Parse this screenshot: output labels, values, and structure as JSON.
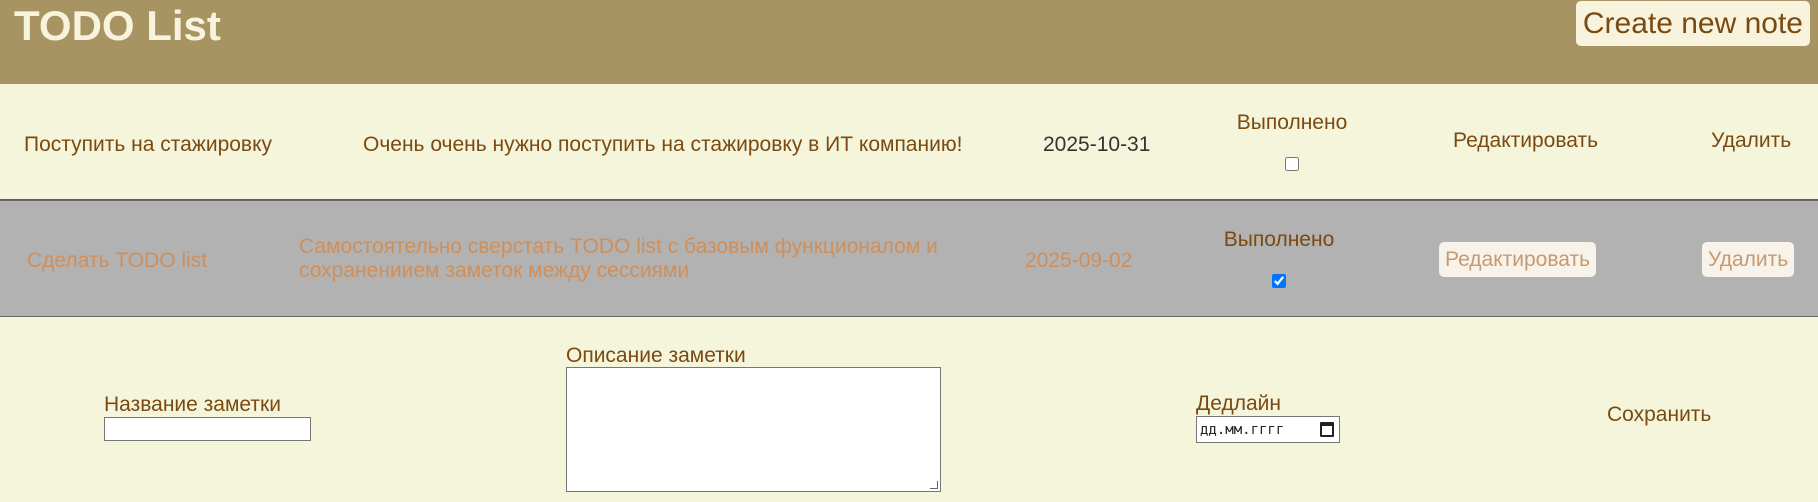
{
  "header": {
    "title": "TODO List",
    "create_label": "Create new note"
  },
  "notes": [
    {
      "title": "Поступить на стажировку",
      "description": "Очень очень нужно поступить на стажировку в ИТ компанию!",
      "deadline": "2025-10-31",
      "status_label": "Выполнено",
      "done": false,
      "edit_label": "Редактировать",
      "delete_label": "Удалить"
    },
    {
      "title": "Сделать TODO list",
      "description": "Самостоятельно сверстать TODO list с базовым функционалом и сохранениием заметок между сессиями",
      "deadline": "2025-09-02",
      "status_label": "Выполнено",
      "done": true,
      "edit_label": "Редактировать",
      "delete_label": "Удалить"
    }
  ],
  "form": {
    "title_label": "Название заметки",
    "title_value": "",
    "description_label": "Описание заметки",
    "description_value": "",
    "deadline_label": "Дедлайн",
    "deadline_placeholder": "дд.мм.гггг",
    "save_label": "Сохранить"
  },
  "colors": {
    "header_bg": "#a89462",
    "page_bg": "#f5f5dc",
    "done_row_bg": "#b2b2b2",
    "text": "#7a4a10",
    "done_text": "#cf8f5a"
  }
}
